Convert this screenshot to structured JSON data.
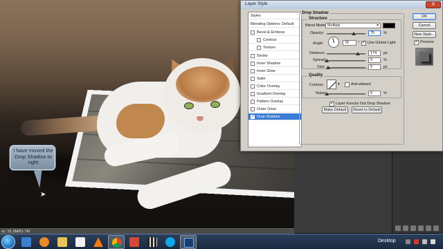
{
  "canvas": {
    "annotation_text": "I have moved the Drop Shadow to right",
    "status_text": "oc: 51.3M/61.7M"
  },
  "dialog": {
    "title": "Layer Style",
    "close_label": "X",
    "styles_list": {
      "header": "Styles",
      "items": [
        {
          "label": "Blending Options: Default",
          "type": "header",
          "checked": false
        },
        {
          "label": "Bevel & Emboss",
          "type": "main",
          "checked": false
        },
        {
          "label": "Contour",
          "type": "sub",
          "checked": false
        },
        {
          "label": "Texture",
          "type": "sub",
          "checked": false
        },
        {
          "label": "Stroke",
          "type": "main",
          "checked": false
        },
        {
          "label": "Inner Shadow",
          "type": "main",
          "checked": false
        },
        {
          "label": "Inner Glow",
          "type": "main",
          "checked": false
        },
        {
          "label": "Satin",
          "type": "main",
          "checked": false
        },
        {
          "label": "Color Overlay",
          "type": "main",
          "checked": false
        },
        {
          "label": "Gradient Overlay",
          "type": "main",
          "checked": false
        },
        {
          "label": "Pattern Overlay",
          "type": "main",
          "checked": false
        },
        {
          "label": "Outer Glow",
          "type": "main",
          "checked": false
        },
        {
          "label": "Drop Shadow",
          "type": "main",
          "checked": true,
          "selected": true
        }
      ]
    },
    "drop_shadow": {
      "group_title": "Drop Shadow",
      "structure_title": "Structure",
      "blend_mode_label": "Blend Mode:",
      "blend_mode_value": "Multiply",
      "shadow_color": "#000000",
      "opacity_label": "Opacity:",
      "opacity_value": "75",
      "opacity_unit": "%",
      "angle_label": "Angle:",
      "angle_value": "76",
      "angle_unit": "°",
      "use_global_light_label": "Use Global Light",
      "use_global_light": true,
      "distance_label": "Distance:",
      "distance_value": "174",
      "distance_unit": "px",
      "spread_label": "Spread:",
      "spread_value": "0",
      "spread_unit": "%",
      "size_label": "Size:",
      "size_value": "5",
      "size_unit": "px"
    },
    "quality": {
      "title": "Quality",
      "contour_label": "Contour:",
      "anti_aliased_label": "Anti-aliased",
      "anti_aliased": false,
      "noise_label": "Noise:",
      "noise_value": "0",
      "noise_unit": "%"
    },
    "knockout_label": "Layer Knocks Out Drop Shadow",
    "knockout": true,
    "make_default_label": "Make Default",
    "reset_default_label": "Reset to Default",
    "buttons": {
      "ok": "OK",
      "cancel": "Cancel",
      "new_style": "New Style...",
      "preview": "Preview"
    }
  },
  "taskbar": {
    "desktop_label": "Desktop",
    "apps": [
      "explorer",
      "media",
      "folder",
      "notes",
      "vlc",
      "chrome",
      "app",
      "video",
      "skype",
      "photoshop"
    ],
    "active_app": "photoshop"
  }
}
